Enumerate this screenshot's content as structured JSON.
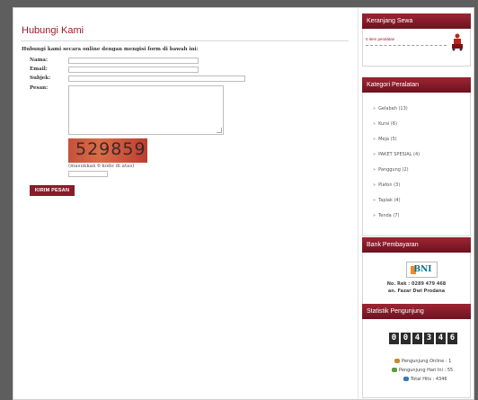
{
  "contact": {
    "title": "Hubungi Kami",
    "intro": "Hubungi kami secara online dengan mengisi form di bawah ini:",
    "fields": [
      {
        "label": "Nama:"
      },
      {
        "label": "Email:"
      },
      {
        "label": "Subjek:"
      },
      {
        "label": "Pesan:"
      }
    ],
    "captcha_code": "529859",
    "captcha_hint": "(masukkan 6 kode di atas)",
    "submit_label": "KIRIM PESAN"
  },
  "sidebar": {
    "cart": {
      "title": "Keranjang Sewa",
      "text": "0 item peralatan"
    },
    "categories": {
      "title": "Kategori Peralatan",
      "items": [
        "Gelabah (13)",
        "Kursi (6)",
        "Meja (5)",
        "PAKET SPESIAL (4)",
        "Panggung (2)",
        "Plafon (3)",
        "Taplak (4)",
        "Tenda (7)"
      ]
    },
    "bank": {
      "title": "Bank Pembayaran",
      "logo_text": "BNI",
      "account": "No. Rek : 0289 479 468",
      "holder": "an. Fazar Dwi Prodana"
    },
    "stats": {
      "title": "Statistik Pengunjung",
      "counter_digits": [
        "0",
        "0",
        "4",
        "3",
        "4",
        "6"
      ],
      "online": "Pengunjung Online : 1",
      "today": "Pengunjung Hari Ini : 55",
      "total": "Total Hits : 4346"
    }
  },
  "colors": {
    "brand": "#8b1b28",
    "page_bg": "#5e5e5e"
  }
}
